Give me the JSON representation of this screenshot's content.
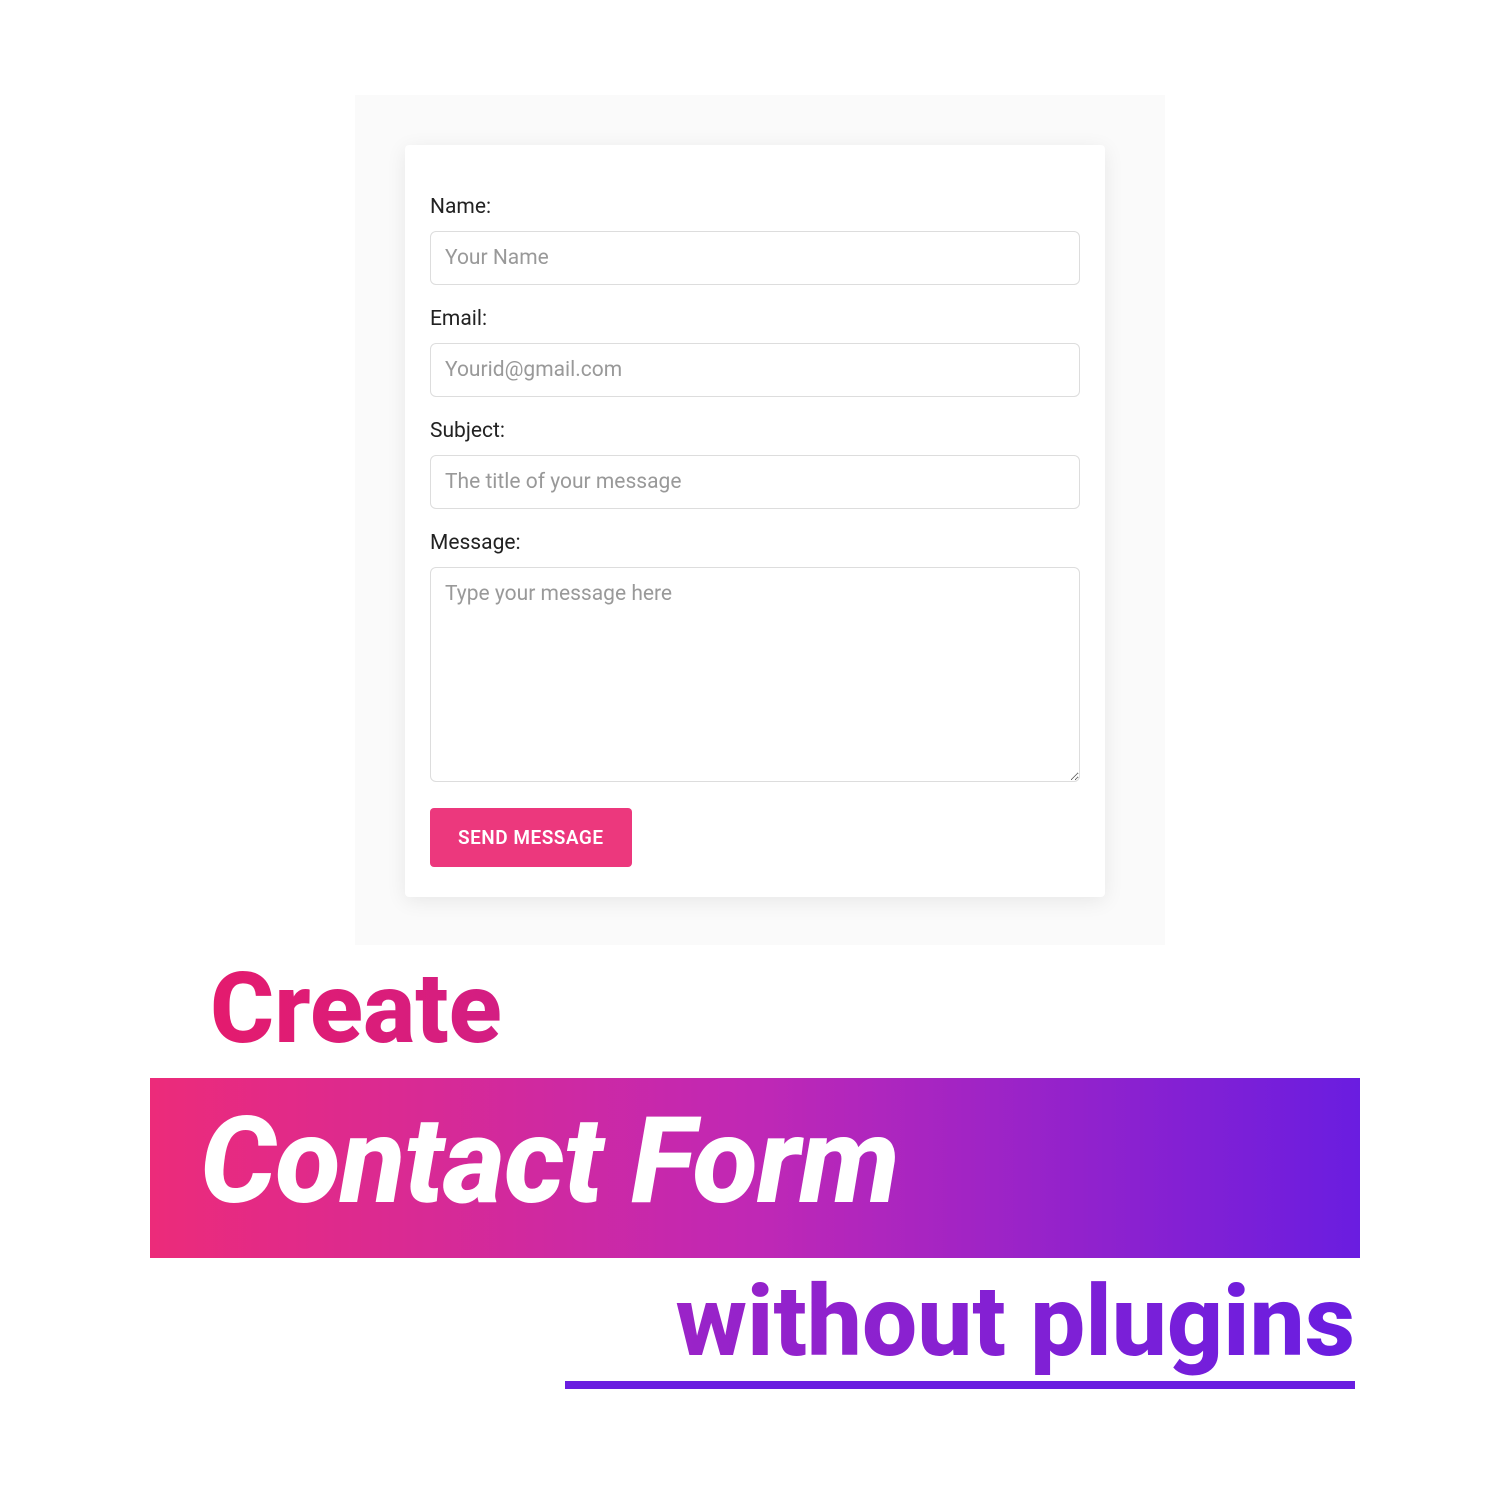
{
  "form": {
    "fields": {
      "name": {
        "label": "Name:",
        "placeholder": "Your Name"
      },
      "email": {
        "label": "Email:",
        "placeholder": "Yourid@gmail.com"
      },
      "subject": {
        "label": "Subject:",
        "placeholder": "The title of your message"
      },
      "message": {
        "label": "Message:",
        "placeholder": "Type your message here"
      }
    },
    "submit_label": "SEND MESSAGE"
  },
  "headline": {
    "line1": "Create",
    "line2": "Contact Form",
    "line3": "without plugins"
  },
  "colors": {
    "accent_pink": "#ec387d",
    "gradient_start": "#ec2b7a",
    "gradient_mid": "#c028b5",
    "gradient_end": "#6a1de0"
  }
}
